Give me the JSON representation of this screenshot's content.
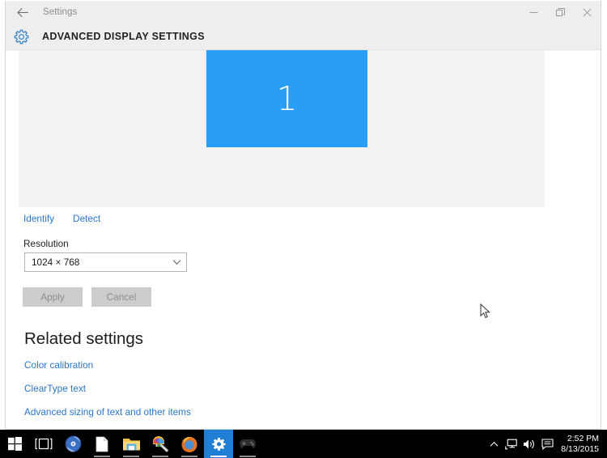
{
  "window": {
    "app_title": "Settings",
    "back_icon": "back-arrow-icon",
    "page_title": "ADVANCED DISPLAY SETTINGS",
    "gear_icon": "gear-icon",
    "controls": {
      "minimize": "minimize-icon",
      "maximize": "maximize-icon",
      "close": "close-icon"
    }
  },
  "display": {
    "monitor_number": "1",
    "monitor_color": "#2a9df4",
    "identify_label": "Identify",
    "detect_label": "Detect",
    "resolution_label": "Resolution",
    "resolution_value": "1024 × 768",
    "chevron_icon": "chevron-down-icon",
    "apply_label": "Apply",
    "cancel_label": "Cancel"
  },
  "related": {
    "heading": "Related settings",
    "links": [
      "Color calibration",
      "ClearType text",
      "Advanced sizing of text and other items"
    ]
  },
  "taskbar": {
    "items": [
      {
        "name": "start-button",
        "icon": "windows-logo-icon"
      },
      {
        "name": "task-view-button",
        "icon": "task-view-icon"
      },
      {
        "name": "media-player-button",
        "icon": "media-disc-icon"
      },
      {
        "name": "document-button",
        "icon": "document-icon"
      },
      {
        "name": "file-explorer-button",
        "icon": "folder-icon"
      },
      {
        "name": "paint-button",
        "icon": "paint-icon"
      },
      {
        "name": "firefox-button",
        "icon": "firefox-icon"
      },
      {
        "name": "settings-button",
        "icon": "settings-gear-icon"
      },
      {
        "name": "game-button",
        "icon": "game-controller-icon"
      }
    ],
    "tray": {
      "show_hidden_icon": "chevron-up-icon",
      "network_icon": "network-icon",
      "volume_icon": "volume-icon",
      "action_center_icon": "action-center-icon",
      "time": "2:52 PM",
      "date": "8/13/2015"
    }
  },
  "colors": {
    "accent_blue": "#2a9df4",
    "link_blue": "#2a76c8",
    "header_grey": "#eeeeee",
    "panel_grey": "#f2f2f2"
  }
}
